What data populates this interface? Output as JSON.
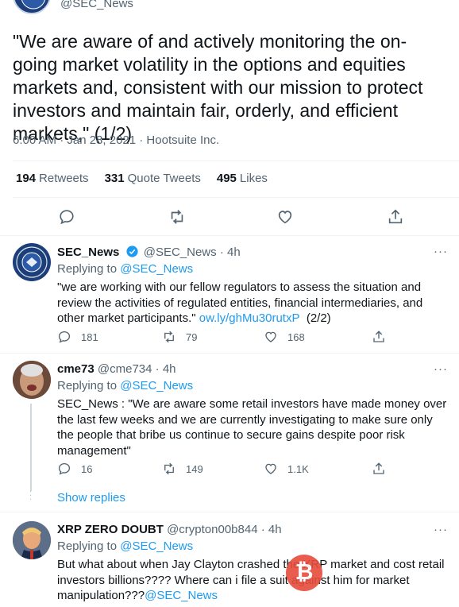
{
  "main_tweet": {
    "handle": "@SEC_News",
    "text": "\"We are aware of and actively monitoring the on-going market volatility in the options and equities markets and, consistent with our mission to protect investors and maintain fair, orderly, and efficient markets,\" (1/2)",
    "meta": "6:00 AM · Jan 28, 2021 · Hootsuite Inc.",
    "stats": {
      "retweets_count": "194",
      "retweets_label": "Retweets",
      "quotes_count": "331",
      "quotes_label": "Quote Tweets",
      "likes_count": "495",
      "likes_label": "Likes"
    }
  },
  "replies": [
    {
      "name": "SEC_News",
      "handle": "@SEC_News",
      "sep": "·",
      "time": "4h",
      "replying_prefix": "Replying to",
      "replying_to": "@SEC_News",
      "text": "\"we are working with our fellow regulators to assess the situation and review the activities of regulated entities, financial intermediaries, and other market participants.\"",
      "link": "ow.ly/ghMu30rutxP",
      "suffix": "(2/2)",
      "reply_count": "181",
      "retweet_count": "79",
      "like_count": "168"
    },
    {
      "name": "cme73",
      "handle": "@cme734",
      "sep": "·",
      "time": "4h",
      "replying_prefix": "Replying to",
      "replying_to": "@SEC_News",
      "text": "SEC_News : \"We are aware some retail investors have made money over the last few weeks and we are currently investigating to make sure only the people that bribe us continue to secure gains despite poor risk management\"",
      "reply_count": "16",
      "retweet_count": "149",
      "like_count": "1.1K"
    },
    {
      "name": "XRP ZERO DOUBT",
      "handle": "@crypton00b844",
      "sep": "·",
      "time": "4h",
      "replying_prefix": "Replying to",
      "replying_to": "@SEC_News",
      "text": "But what about when Jay Clayton crashed the XRP market and cost retail investors billions???? Where can i file a suit against him for market manipulation???",
      "mention": "@SEC_News"
    }
  ],
  "show_replies": "Show replies",
  "more_label": "···",
  "colors": {
    "accent": "#1d9bf0",
    "muted": "#536471",
    "text": "#0f1419"
  },
  "icons": [
    "reply-icon",
    "retweet-icon",
    "like-icon",
    "share-icon",
    "verified-icon",
    "more-icon"
  ]
}
